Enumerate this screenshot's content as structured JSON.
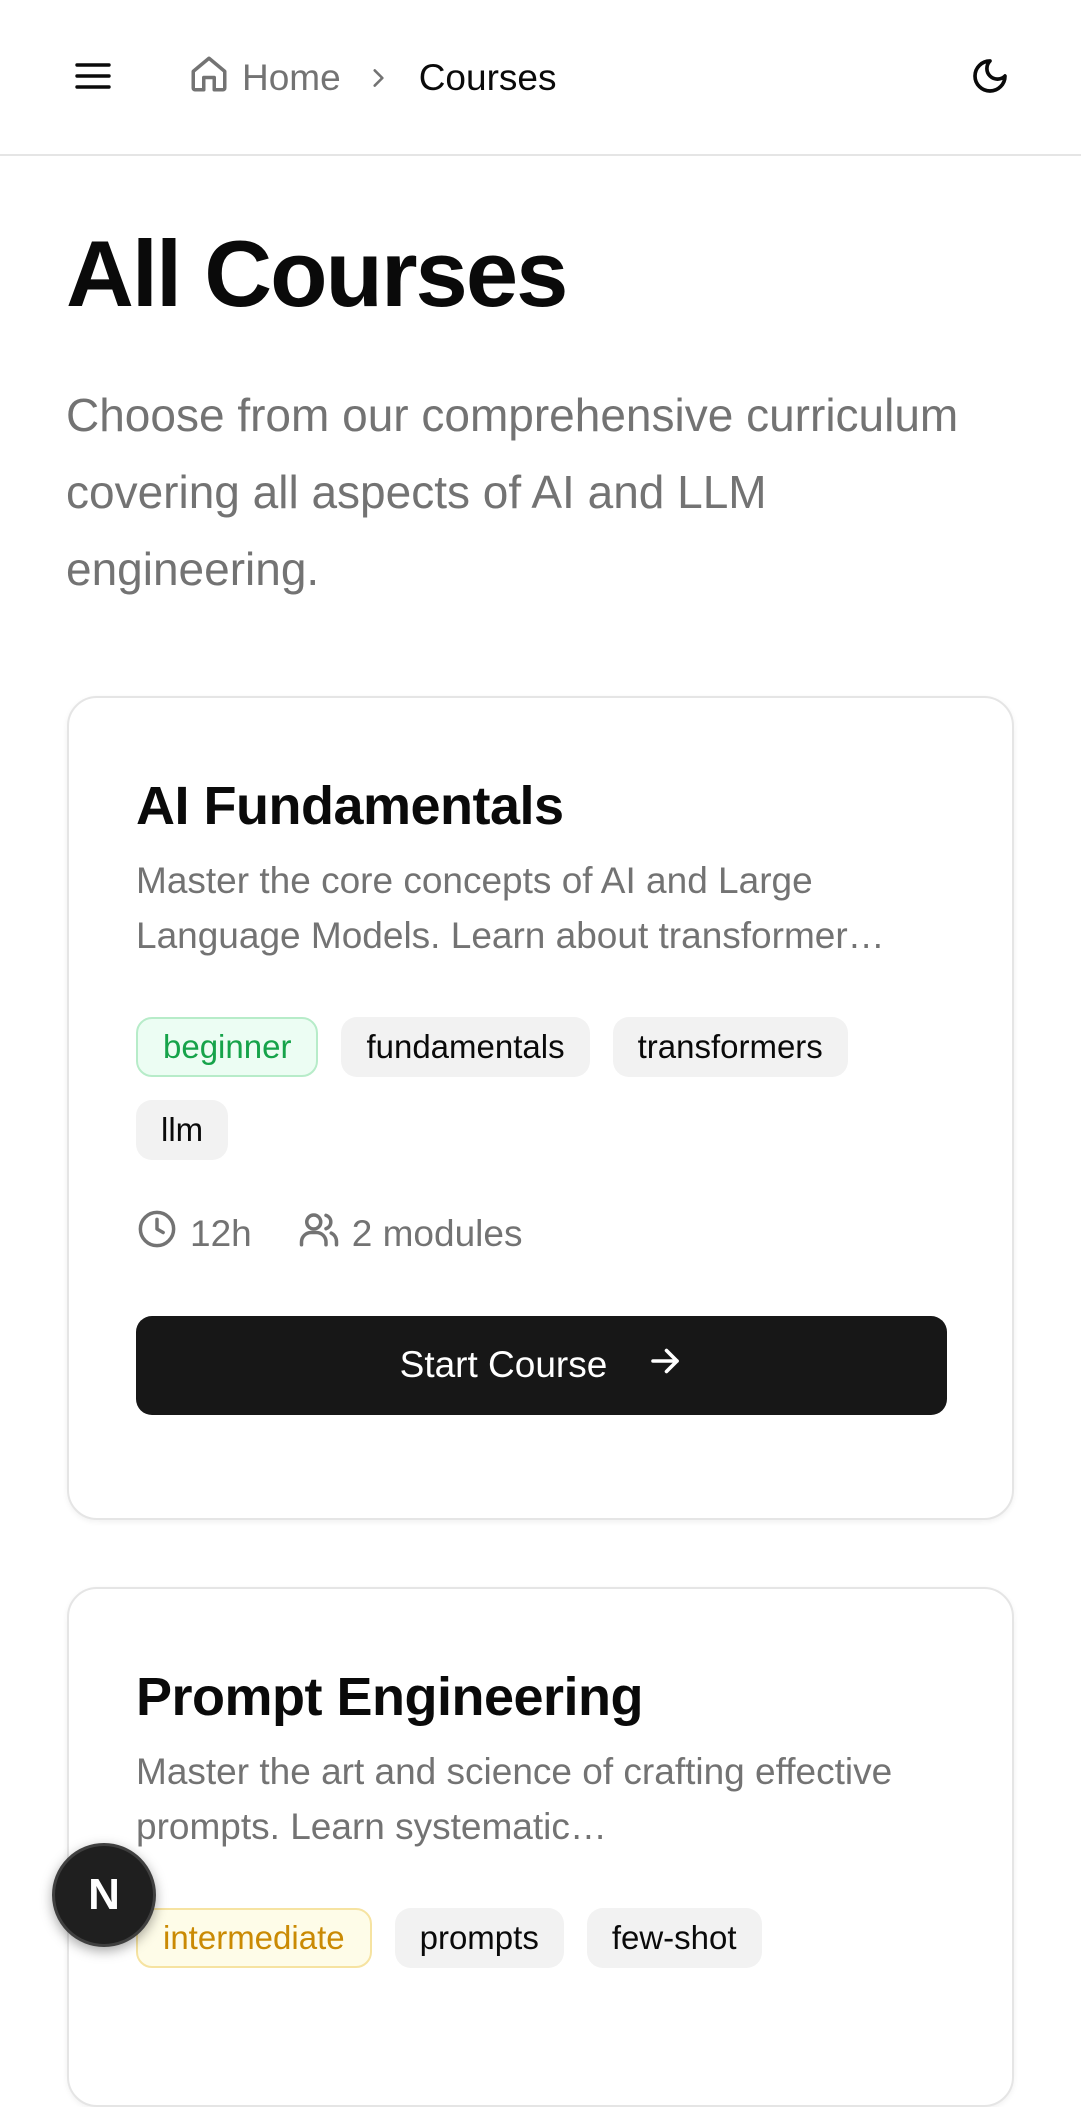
{
  "header": {
    "menu_icon": "menu-icon",
    "breadcrumb": {
      "home_icon": "home-icon",
      "home_label": "Home",
      "separator_icon": "chevron-right-icon",
      "current_label": "Courses"
    },
    "theme_toggle_icon": "moon-icon"
  },
  "page": {
    "title": "All Courses",
    "subtitle": "Choose from our comprehensive curriculum covering all aspects of AI and LLM engineering."
  },
  "courses": [
    {
      "title": "AI Fundamentals",
      "description": "Master the core concepts of AI and Large Language Models. Learn about transformer…",
      "tags": [
        "beginner",
        "fundamentals",
        "transformers",
        "llm"
      ],
      "duration": "12h",
      "modules": "2 modules",
      "button_label": "Start Course"
    },
    {
      "title": "Prompt Engineering",
      "description": "Master the art and science of crafting effective prompts. Learn systematic…",
      "tags": [
        "intermediate",
        "prompts",
        "few-shot"
      ]
    }
  ],
  "floating_badge": {
    "label": "N"
  },
  "colors": {
    "primary_button": "#171717",
    "beginner_text": "#16a34a",
    "beginner_bg": "#ecfdf3",
    "intermediate_text": "#ca8a04",
    "intermediate_bg": "#fefce8",
    "muted_text": "#737373"
  }
}
